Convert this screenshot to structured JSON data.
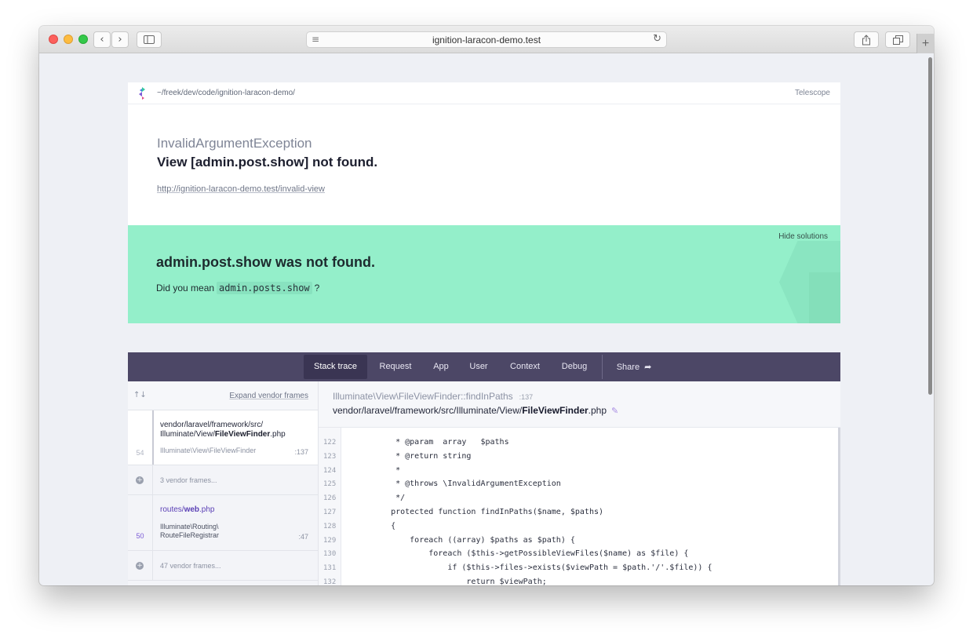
{
  "browser": {
    "url": "ignition-laracon-demo.test",
    "back_icon": "‹",
    "forward_icon": "›",
    "reload_icon": "↻",
    "new_tab_icon": "+"
  },
  "header": {
    "path": "~/freek/dev/code/ignition-laracon-demo/",
    "telescope_label": "Telescope"
  },
  "exception": {
    "class": "InvalidArgumentException",
    "message": "View [admin.post.show] not found.",
    "url": "http://ignition-laracon-demo.test/invalid-view"
  },
  "solution": {
    "hide_label": "Hide solutions",
    "title": "admin.post.show was not found.",
    "text_before": "Did you mean",
    "suggestion": "admin.posts.show",
    "text_after": "?"
  },
  "tabs": {
    "stack_trace": "Stack trace",
    "request": "Request",
    "app": "App",
    "user": "User",
    "context": "Context",
    "debug": "Debug",
    "share": "Share"
  },
  "frames": {
    "sort_icon": "↑↓",
    "expand_vendor": "Expand vendor frames",
    "frame1": {
      "number": "54",
      "file_dir": "vendor/laravel/framework/src/",
      "file_dir2": "Illuminate/View/",
      "file_name": "FileViewFinder",
      "file_ext": ".php",
      "class": "Illuminate\\View\\FileViewFinder",
      "line": ":137"
    },
    "vendor1": "3 vendor frames...",
    "frame2": {
      "number": "50",
      "file_dir": "routes/",
      "file_name": "web",
      "file_ext": ".php",
      "class_line1": "Illuminate\\Routing\\",
      "class_line2": "RouteFileRegistrar",
      "line": ":47"
    },
    "vendor2": "47 vendor frames..."
  },
  "code": {
    "method": "Illuminate\\View\\FileViewFinder::findInPaths",
    "method_line": ":137",
    "file_dir": "vendor/laravel/framework/src/Illuminate/View/",
    "file_name": "FileViewFinder",
    "file_ext": ".php",
    "lines": [
      {
        "n": "122",
        "text": "     * @param  array   $paths"
      },
      {
        "n": "123",
        "text": "     * @return string"
      },
      {
        "n": "124",
        "text": "     *"
      },
      {
        "n": "125",
        "text": "     * @throws \\InvalidArgumentException"
      },
      {
        "n": "126",
        "text": "     */"
      },
      {
        "n": "127",
        "text": "    protected function findInPaths($name, $paths)"
      },
      {
        "n": "128",
        "text": "    {"
      },
      {
        "n": "129",
        "text": "        foreach ((array) $paths as $path) {"
      },
      {
        "n": "130",
        "text": "            foreach ($this->getPossibleViewFiles($name) as $file) {"
      },
      {
        "n": "131",
        "text": "                if ($this->files->exists($viewPath = $path.'/'.$file)) {"
      },
      {
        "n": "132",
        "text": "                    return $viewPath;"
      }
    ]
  }
}
